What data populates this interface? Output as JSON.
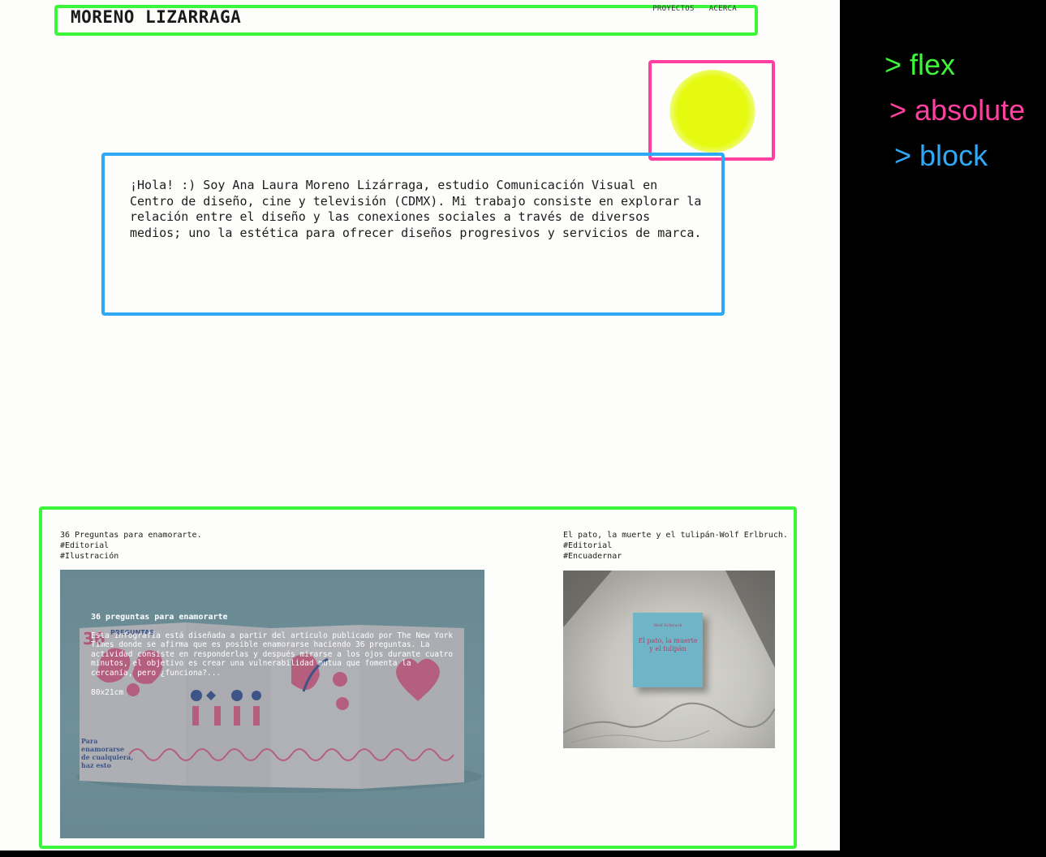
{
  "header": {
    "brand": "MORENO LIZARRAGA",
    "nav": [
      "PROYECTOS",
      "ACERCA"
    ]
  },
  "bio": {
    "text": "¡Hola! :) Soy Ana Laura Moreno Lizárraga, estudio Comunicación Visual en Centro de diseño, cine y televisión (CDMX). Mi trabajo consiste en explorar la relación entre el diseño y las conexiones sociales a través de diversos medios; uno la estética para ofrecer diseños progresivos y servicios de marca."
  },
  "projects": [
    {
      "title": "36 Preguntas para enamorarte.",
      "tags": [
        "#Editorial",
        "#Ilustración"
      ],
      "overlay": {
        "title": "36 preguntas para enamorarte",
        "description": "Esta infografía está diseñada a partir del artículo publicado por The New York Times donde se afirma que es posible enamorarse haciendo 36 preguntas. La actividad consiste en responderlas y después mirarse a los ojos durante cuatro minutos, el objetivo es crear una vulnerabilidad mutua que fomenta la cercanía, pero ¿funciona?...",
        "dimensions": "80x21cm"
      },
      "image_text": {
        "number": "36",
        "headline": "PREGUNTAS",
        "side_text": "Para enamorarse de cualquiera, haz esto"
      }
    },
    {
      "title": "El pato, la muerte y el tulipán-Wolf Erlbruch.",
      "tags": [
        "#Editorial",
        "#Encuadernar"
      ],
      "image_text": {
        "book_author": "Wolf Erlbruch",
        "book_title": "El pato, la muerte y el tulipán"
      }
    }
  ],
  "legend": [
    {
      "label": "> flex",
      "color": "#3df53a"
    },
    {
      "label": "> absolute",
      "color": "#ff40a0"
    },
    {
      "label": "> block",
      "color": "#2fa8f5"
    }
  ],
  "colors": {
    "flex_outline": "#3df53a",
    "absolute_outline": "#ff40a0",
    "block_outline": "#2fa8f5",
    "sun": "#e6fa10",
    "page_background": "#fdfdfb",
    "side_panel": "#000000"
  }
}
